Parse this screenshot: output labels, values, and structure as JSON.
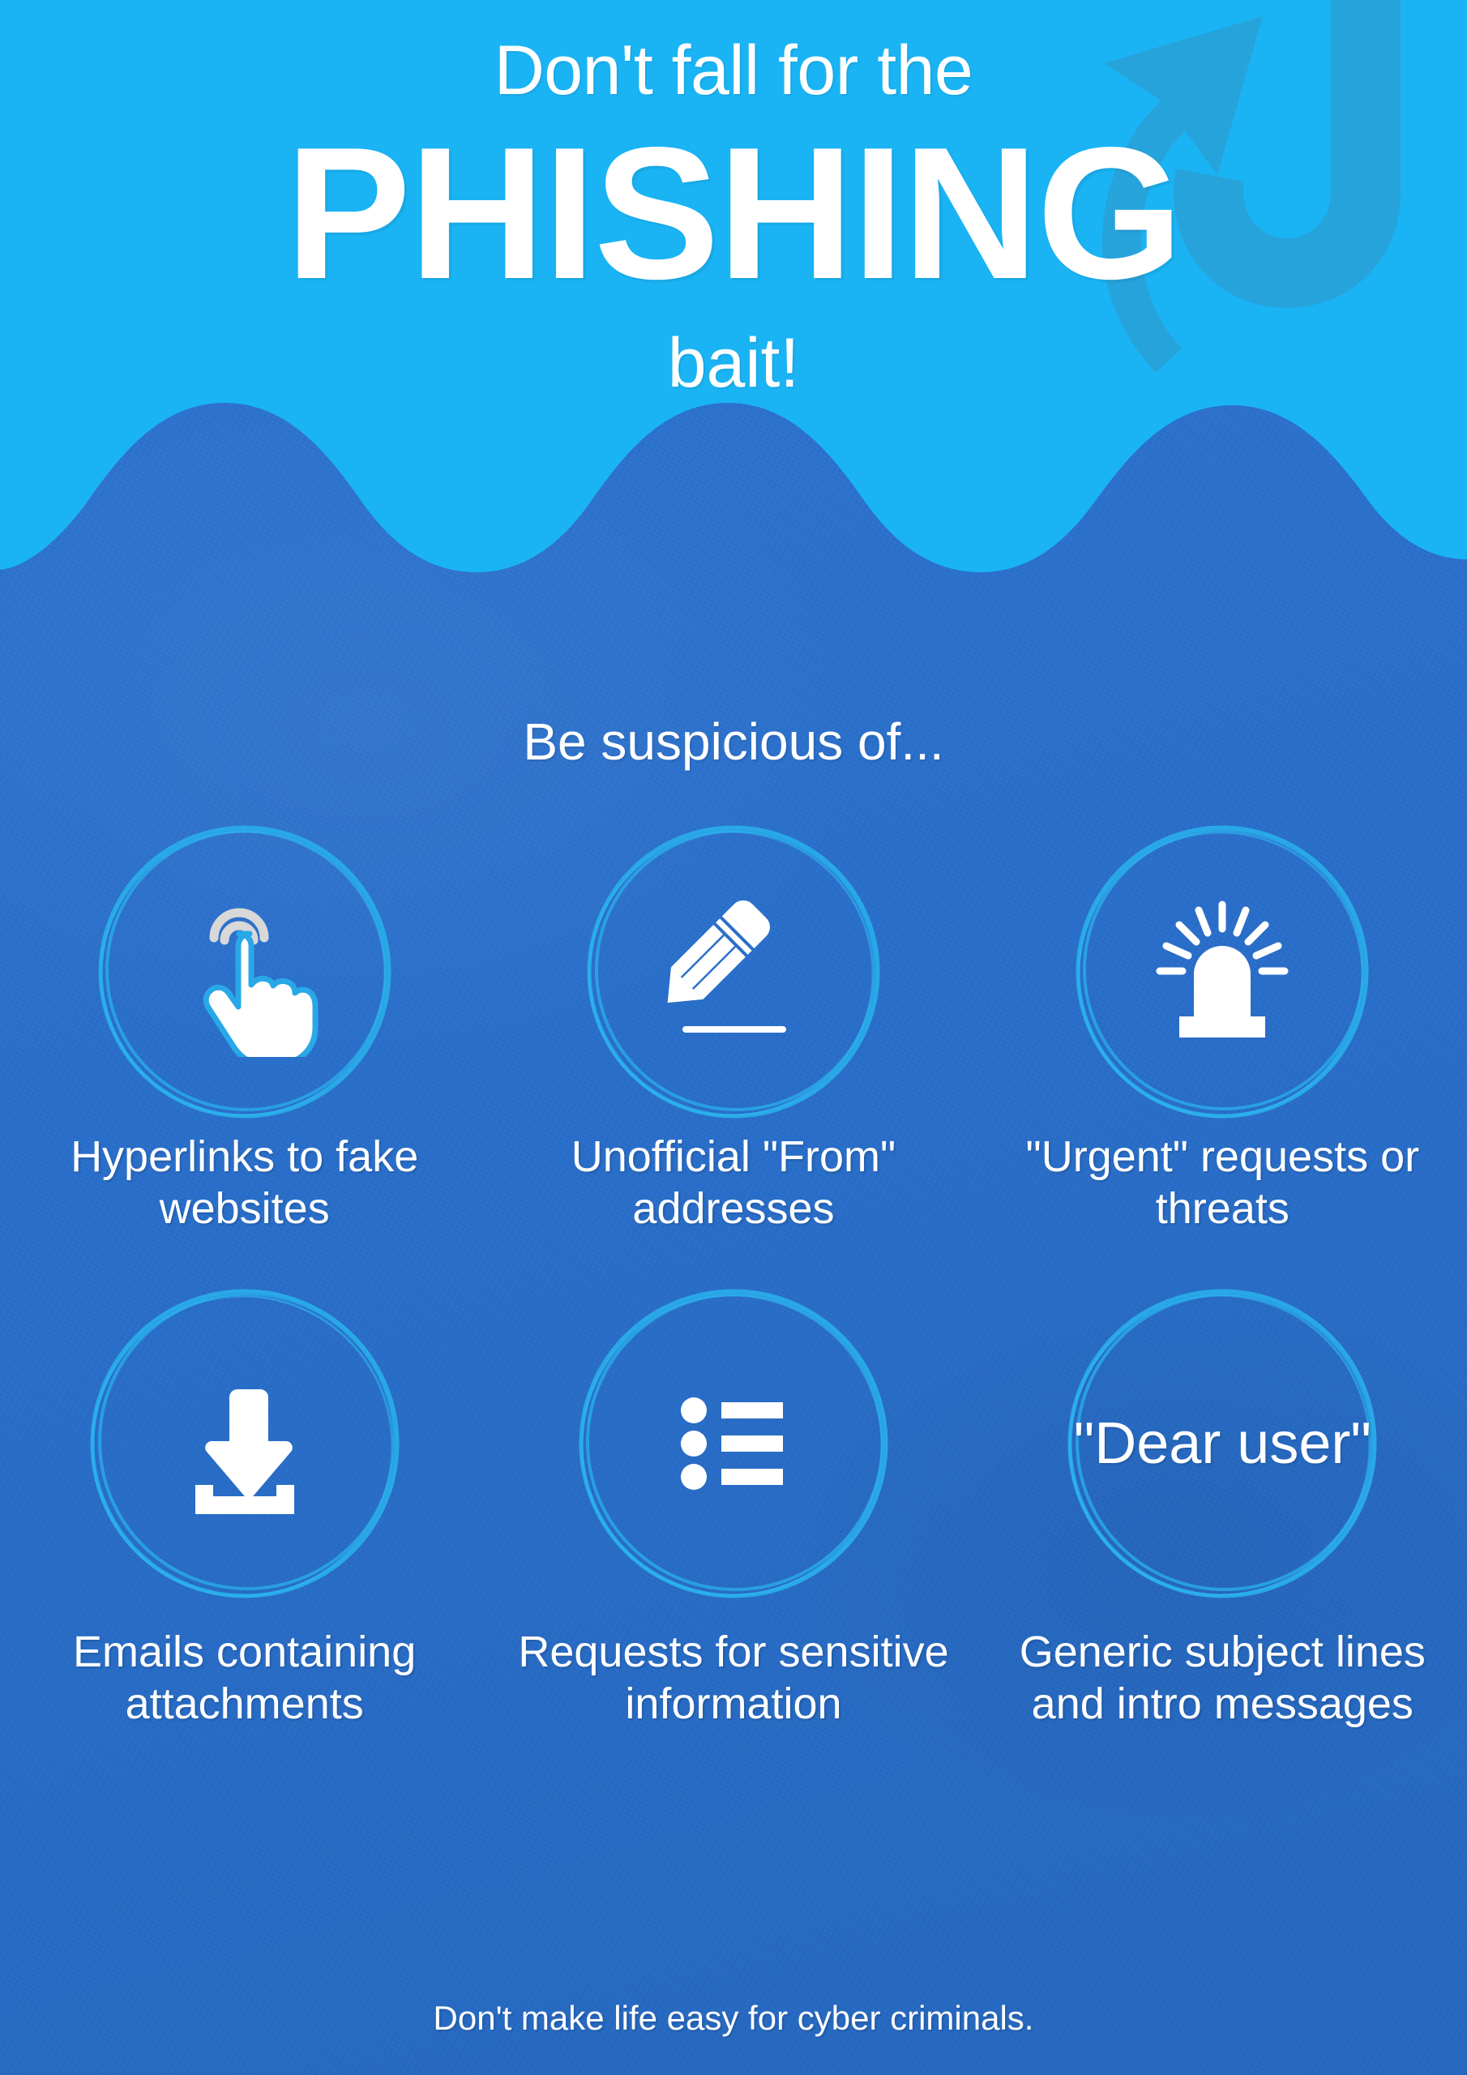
{
  "colors": {
    "header_bg": "#1ab4f5",
    "body_bg": "#2a6fca",
    "hook_decor": "#27a3dc",
    "ring": "#29a8e8",
    "text": "#ffffff",
    "icon_white": "#ffffff",
    "icon_grey": "#d8d8d8"
  },
  "header": {
    "line1": "Don't fall for the",
    "headline": "PHISHING",
    "line3": "bait!",
    "decoration_icon": "fish-hook-arrow-icon"
  },
  "main": {
    "subheading": "Be suspicious of...",
    "items": [
      {
        "icon": "click-hand-cursor-icon",
        "caption": "Hyperlinks to fake websites"
      },
      {
        "icon": "pencil-writing-icon",
        "caption": "Unofficial \"From\" addresses"
      },
      {
        "icon": "siren-alarm-light-icon",
        "caption": "\"Urgent\" requests or threats"
      },
      {
        "icon": "download-attachment-icon",
        "caption": "Emails containing attachments"
      },
      {
        "icon": "bulleted-list-icon",
        "caption": "Requests for sensitive information"
      },
      {
        "icon": "dear-user-text-icon",
        "text": "\"Dear user\"",
        "caption": "Generic subject lines and intro messages"
      }
    ]
  },
  "footer": {
    "tagline": "Don't make life easy for cyber criminals."
  }
}
